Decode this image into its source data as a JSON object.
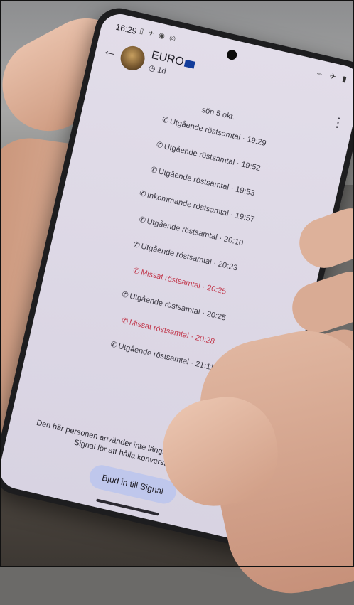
{
  "status": {
    "time": "16:29",
    "notif_icons": "▯ ✈ ◉ ◎",
    "sys_icons": "⇔ ✈ ▮"
  },
  "header": {
    "back_icon": "arrow-left-icon",
    "contact_name": "EURO",
    "timer": "1d",
    "menu_icon": "more-vertical-icon"
  },
  "conversation": {
    "date": "sön 5 okt.",
    "calls": [
      {
        "text": "Utgående röstsamtal · 19:29",
        "missed": false
      },
      {
        "text": "Utgående röstsamtal · 19:52",
        "missed": false
      },
      {
        "text": "Utgående röstsamtal · 19:53",
        "missed": false
      },
      {
        "text": "Inkommande röstsamtal · 19:57",
        "missed": false
      },
      {
        "text": "Utgående röstsamtal · 20:10",
        "missed": false
      },
      {
        "text": "Utgående röstsamtal · 20:23",
        "missed": false
      },
      {
        "text": "Missat röstsamtal · 20:25",
        "missed": true
      },
      {
        "text": "Utgående röstsamtal · 20:25",
        "missed": false
      },
      {
        "text": "Missat röstsamtal · 20:28",
        "missed": true
      },
      {
        "text": "Utgående röstsamtal · 21:11",
        "missed": false
      }
    ]
  },
  "footer": {
    "notice": "Den här personen använder inte längre Signal. Bjud in dem till Signal för att hålla konversationen här.",
    "invite_button": "Bjud in till Signal"
  },
  "colors": {
    "screen_bg": "#e2dde9",
    "missed": "#c23a4e",
    "button_bg": "#bfc7ec"
  }
}
